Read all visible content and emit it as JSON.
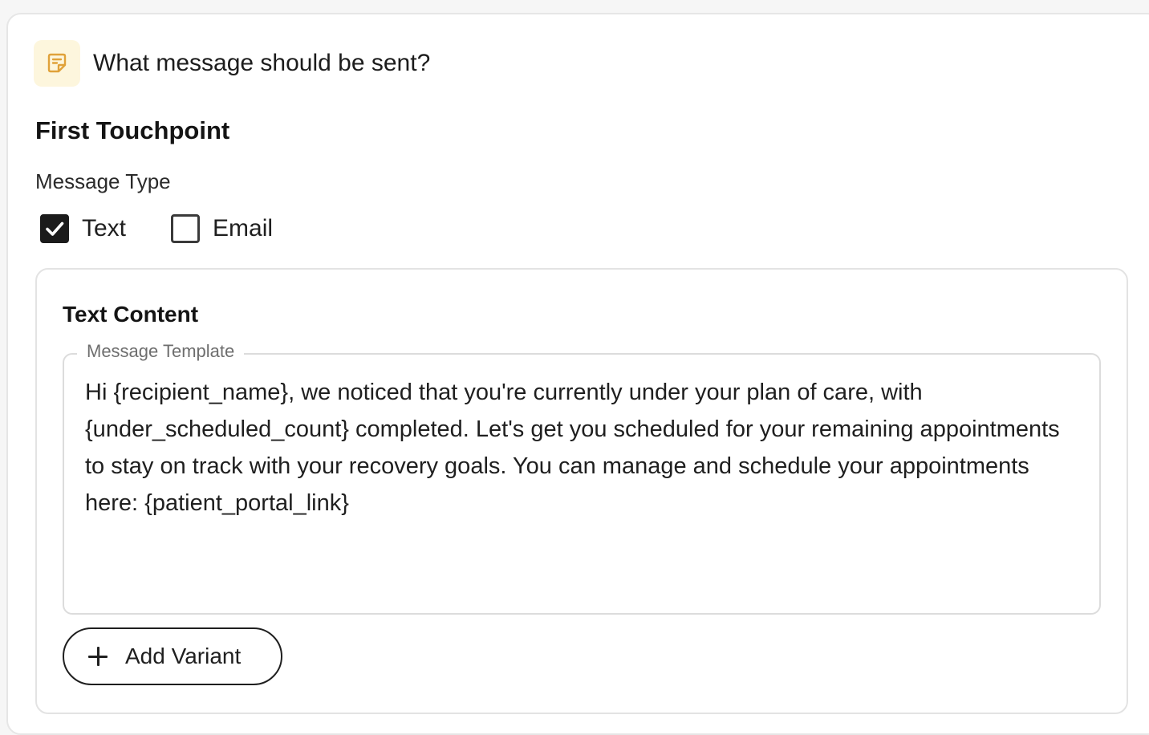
{
  "header": {
    "icon": "note-icon",
    "icon_color": "#e0a23a",
    "icon_bg": "#fdf6dd",
    "title": "What message should be sent?"
  },
  "section": {
    "title": "First Touchpoint"
  },
  "message_type": {
    "label": "Message Type",
    "options": [
      {
        "label": "Text",
        "checked": true
      },
      {
        "label": "Email",
        "checked": false
      }
    ]
  },
  "content": {
    "title": "Text Content",
    "template_label": "Message Template",
    "template_value": "Hi {recipient_name}, we noticed that you're currently under your plan of care, with {under_scheduled_count} completed. Let's get you scheduled for your remaining appointments to stay on track with your recovery goals. You can manage and schedule your appointments here: {patient_portal_link}",
    "add_variant_label": "Add Variant"
  }
}
